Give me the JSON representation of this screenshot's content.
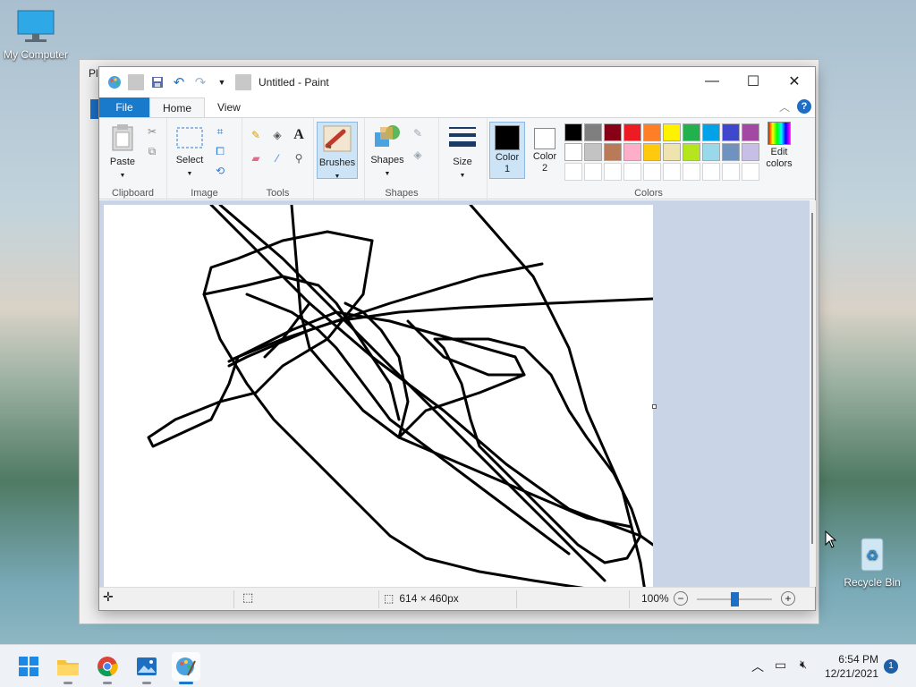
{
  "desktop": {
    "my_computer_label": "My Computer",
    "recycle_bin_label": "Recycle Bin",
    "background_window_title": "Pl"
  },
  "window": {
    "title": "Untitled - Paint",
    "controls": {
      "minimize": "minimize-icon",
      "maximize": "maximize-icon",
      "close": "close-icon"
    }
  },
  "tabs": {
    "file": "File",
    "home": "Home",
    "view": "View"
  },
  "ribbon": {
    "clipboard": {
      "paste": "Paste",
      "group": "Clipboard"
    },
    "image": {
      "select": "Select",
      "group": "Image"
    },
    "tools": {
      "group": "Tools"
    },
    "brushes": "Brushes",
    "shapes": {
      "label": "Shapes",
      "group": "Shapes"
    },
    "size": "Size",
    "colors": {
      "color1": "Color\n1",
      "color2": "Color\n2",
      "edit": "Edit\ncolors",
      "group": "Colors",
      "color1_value": "#000000",
      "color2_value": "#ffffff",
      "palette_row1": [
        "#000000",
        "#7f7f7f",
        "#880015",
        "#ed1c24",
        "#ff7f27",
        "#fff200",
        "#22b14c",
        "#00a2e8",
        "#3f48cc",
        "#a349a4"
      ],
      "palette_row2": [
        "#ffffff",
        "#c3c3c3",
        "#b97a57",
        "#ffaec9",
        "#ffc90e",
        "#efe4b0",
        "#b5e61d",
        "#99d9ea",
        "#7092be",
        "#c8bfe7"
      ]
    }
  },
  "status": {
    "canvas_size": "614 × 460px",
    "zoom": "100%",
    "zoom_level": 0.5
  },
  "taskbar": {
    "time": "6:54 PM",
    "date": "12/21/2021",
    "notification_count": "1"
  }
}
